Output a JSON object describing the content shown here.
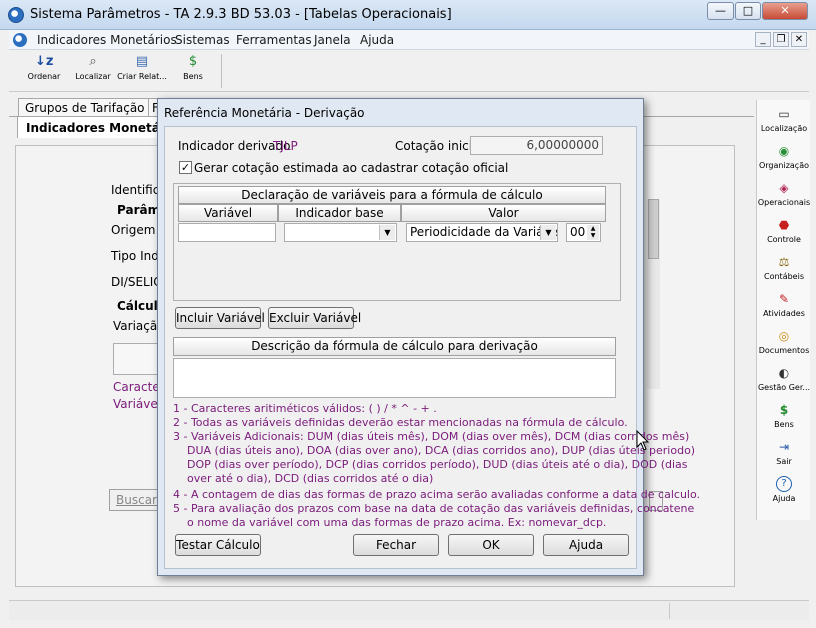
{
  "window": {
    "title": "Sistema Parâmetros -  TA 2.9.3 BD 53.03 - [Tabelas Operacionais]",
    "minimize": "—",
    "maximize": "□",
    "close": "✕"
  },
  "menu": {
    "items": [
      "Indicadores Monetários",
      "Sistemas",
      "Ferramentas",
      "Janela",
      "Ajuda"
    ],
    "mdi_minimize": "_",
    "mdi_restore": "❐",
    "mdi_close": "✕"
  },
  "toolbar": [
    {
      "label": "Ordenar",
      "icon": "sort-az-icon"
    },
    {
      "label": "Localizar",
      "icon": "find-icon"
    },
    {
      "label": "Criar Relat...",
      "icon": "report-icon"
    },
    {
      "label": "Bens",
      "icon": "money-bag-icon"
    }
  ],
  "background": {
    "tabs": [
      "Grupos de Tarifação",
      "F"
    ],
    "active_tab": "Indicadores Monetários",
    "labels": {
      "identificacao": "Identificaç",
      "parametros": "Parâme",
      "origem": "Origem do",
      "tipo": "Tipo Indic",
      "selic": "DI/SELIC",
      "calculo": "Cálculo",
      "variacao": "Variação",
      "caracteres": "Caractere",
      "variaveis": "Variáveis",
      "buscar": "Buscar"
    }
  },
  "sidebar": [
    {
      "label": "Localização",
      "icon": "location-icon"
    },
    {
      "label": "Organização",
      "icon": "organization-icon"
    },
    {
      "label": "Operacionais",
      "icon": "operational-icon"
    },
    {
      "label": "Controle",
      "icon": "control-icon"
    },
    {
      "label": "Contábeis",
      "icon": "accounting-icon"
    },
    {
      "label": "Atividades",
      "icon": "activities-icon"
    },
    {
      "label": "Documentos",
      "icon": "documents-icon"
    },
    {
      "label": "Gestão Ger...",
      "icon": "management-icon"
    },
    {
      "label": "Bens",
      "icon": "money-bag-icon"
    },
    {
      "label": "Sair",
      "icon": "exit-icon"
    },
    {
      "label": "Ajuda",
      "icon": "help-icon"
    }
  ],
  "dialog": {
    "title": "Referência Monetária - Derivação",
    "indicador_label": "Indicador derivado",
    "indicador_value": "TJLP",
    "cotacao_label": "Cotação inicial",
    "cotacao_value": "6,00000000",
    "checkbox_label": "Gerar cotação estimada ao cadastrar cotação oficial",
    "checkbox_checked": true,
    "declaracao_header": "Declaração de variáveis para a fórmula de cálculo",
    "columns": [
      "Variável",
      "Indicador base",
      "Valor"
    ],
    "row": {
      "variavel": "",
      "indicador_base": "",
      "valor": "Periodicidade da Variável",
      "numero": "00"
    },
    "incluir_button": "Incluir Variável",
    "excluir_button": "Excluir Variável",
    "descricao_header": "Descrição da fórmula de cálculo para derivação",
    "descricao_value": "",
    "help": [
      "1 - Caracteres aritiméticos válidos: ( ) / * ^ - + .",
      "2 - Todas as variáveis definidas deverão estar mencionadas na fórmula de cálculo.",
      "3 - Variáveis Adicionais: DUM (dias úteis mês), DOM (dias over mês), DCM (dias corridos mês)",
      "DUA (dias úteis ano), DOA (dias over ano), DCA (dias corridos ano),  DUP (dias úteis periodo)",
      "DOP (dias over período), DCP (dias corridos período), DUD (dias úteis até o dia),  DOD (dias",
      "over até o dia), DCD (dias corridos até o dia)",
      "4 - A contagem de dias das formas de prazo acima serão avaliadas conforme a data de calculo.",
      "5 - Para avaliação dos prazos com base na data de cotação das variáveis definidas, concatene",
      "o nome da variável com uma das formas de prazo acima. Ex: nomevar_dcp."
    ],
    "testar_button": "Testar Cálculo",
    "fechar_button": "Fechar",
    "ok_button": "OK",
    "ajuda_button": "Ajuda"
  }
}
